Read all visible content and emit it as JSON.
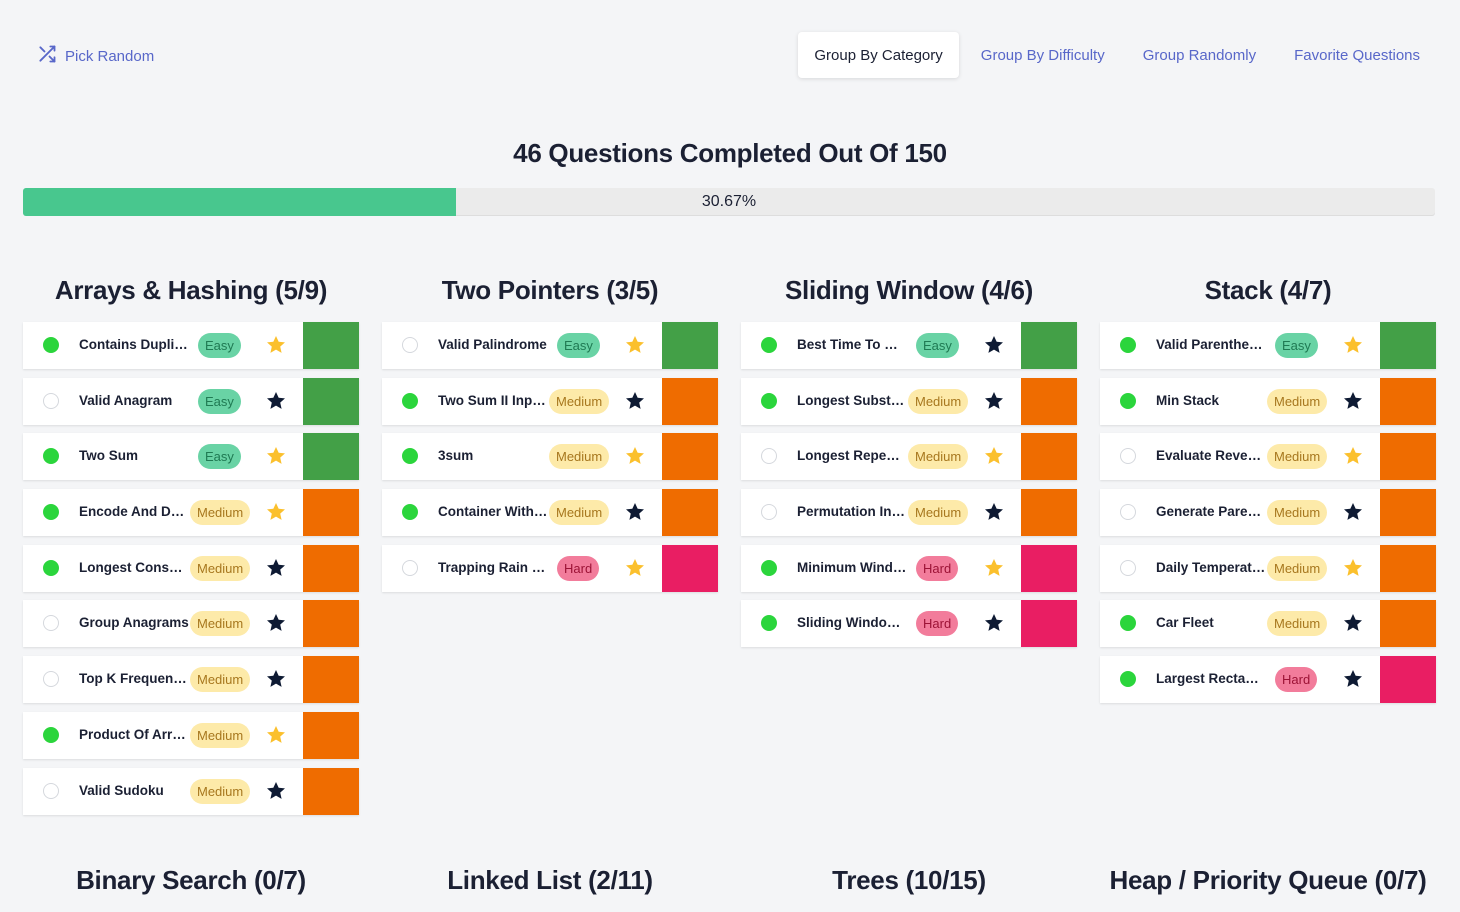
{
  "header": {
    "pick_random_label": "Pick Random",
    "tabs": [
      {
        "label": "Group By Category",
        "active": true
      },
      {
        "label": "Group By Difficulty",
        "active": false
      },
      {
        "label": "Group Randomly",
        "active": false
      },
      {
        "label": "Favorite Questions",
        "active": false
      }
    ]
  },
  "summary": {
    "text": "46 Questions Completed Out Of 150",
    "progress_percent": 30.67,
    "progress_label": "30.67%"
  },
  "colors": {
    "done": "#2bd53c",
    "easy": "#43a047",
    "medium": "#ef6c00",
    "hard": "#e91e63",
    "star_fav": "#fbc02d",
    "star_plain": "#0e1a33",
    "accent": "#5867c9",
    "progress": "#48c78e"
  },
  "categories": [
    {
      "title": "Arrays & Hashing (5/9)",
      "questions": [
        {
          "name": "Contains Duplicate",
          "difficulty": "Easy",
          "done": true,
          "favorite": true
        },
        {
          "name": "Valid Anagram",
          "difficulty": "Easy",
          "done": false,
          "favorite": false
        },
        {
          "name": "Two Sum",
          "difficulty": "Easy",
          "done": true,
          "favorite": true
        },
        {
          "name": "Encode And Deco...",
          "difficulty": "Medium",
          "done": true,
          "favorite": true
        },
        {
          "name": "Longest Consecut...",
          "difficulty": "Medium",
          "done": true,
          "favorite": false
        },
        {
          "name": "Group Anagrams",
          "difficulty": "Medium",
          "done": false,
          "favorite": false
        },
        {
          "name": "Top K Frequent El...",
          "difficulty": "Medium",
          "done": false,
          "favorite": false
        },
        {
          "name": "Product Of Array E...",
          "difficulty": "Medium",
          "done": true,
          "favorite": true
        },
        {
          "name": "Valid Sudoku",
          "difficulty": "Medium",
          "done": false,
          "favorite": false
        }
      ]
    },
    {
      "title": "Two Pointers (3/5)",
      "questions": [
        {
          "name": "Valid Palindrome",
          "difficulty": "Easy",
          "done": false,
          "favorite": true
        },
        {
          "name": "Two Sum II Input A...",
          "difficulty": "Medium",
          "done": true,
          "favorite": false
        },
        {
          "name": "3sum",
          "difficulty": "Medium",
          "done": true,
          "favorite": true
        },
        {
          "name": "Container With Mo...",
          "difficulty": "Medium",
          "done": true,
          "favorite": false
        },
        {
          "name": "Trapping Rain Water",
          "difficulty": "Hard",
          "done": false,
          "favorite": true
        }
      ]
    },
    {
      "title": "Sliding Window (4/6)",
      "questions": [
        {
          "name": "Best Time To Buy ...",
          "difficulty": "Easy",
          "done": true,
          "favorite": false
        },
        {
          "name": "Longest Substring...",
          "difficulty": "Medium",
          "done": true,
          "favorite": false
        },
        {
          "name": "Longest Repeatin...",
          "difficulty": "Medium",
          "done": false,
          "favorite": true
        },
        {
          "name": "Permutation In Str...",
          "difficulty": "Medium",
          "done": false,
          "favorite": false
        },
        {
          "name": "Minimum Window ...",
          "difficulty": "Hard",
          "done": true,
          "favorite": true
        },
        {
          "name": "Sliding Window Ma...",
          "difficulty": "Hard",
          "done": true,
          "favorite": false
        }
      ]
    },
    {
      "title": "Stack (4/7)",
      "questions": [
        {
          "name": "Valid Parentheses",
          "difficulty": "Easy",
          "done": true,
          "favorite": true
        },
        {
          "name": "Min Stack",
          "difficulty": "Medium",
          "done": true,
          "favorite": false
        },
        {
          "name": "Evaluate Reverse ...",
          "difficulty": "Medium",
          "done": false,
          "favorite": true
        },
        {
          "name": "Generate Parenth...",
          "difficulty": "Medium",
          "done": false,
          "favorite": false
        },
        {
          "name": "Daily Temperatures",
          "difficulty": "Medium",
          "done": false,
          "favorite": true
        },
        {
          "name": "Car Fleet",
          "difficulty": "Medium",
          "done": true,
          "favorite": false
        },
        {
          "name": "Largest Rectangle...",
          "difficulty": "Hard",
          "done": true,
          "favorite": false
        }
      ]
    }
  ],
  "next_categories": [
    {
      "title": "Binary Search (0/7)"
    },
    {
      "title": "Linked List (2/11)"
    },
    {
      "title": "Trees (10/15)"
    },
    {
      "title": "Heap / Priority Queue (0/7)"
    }
  ]
}
